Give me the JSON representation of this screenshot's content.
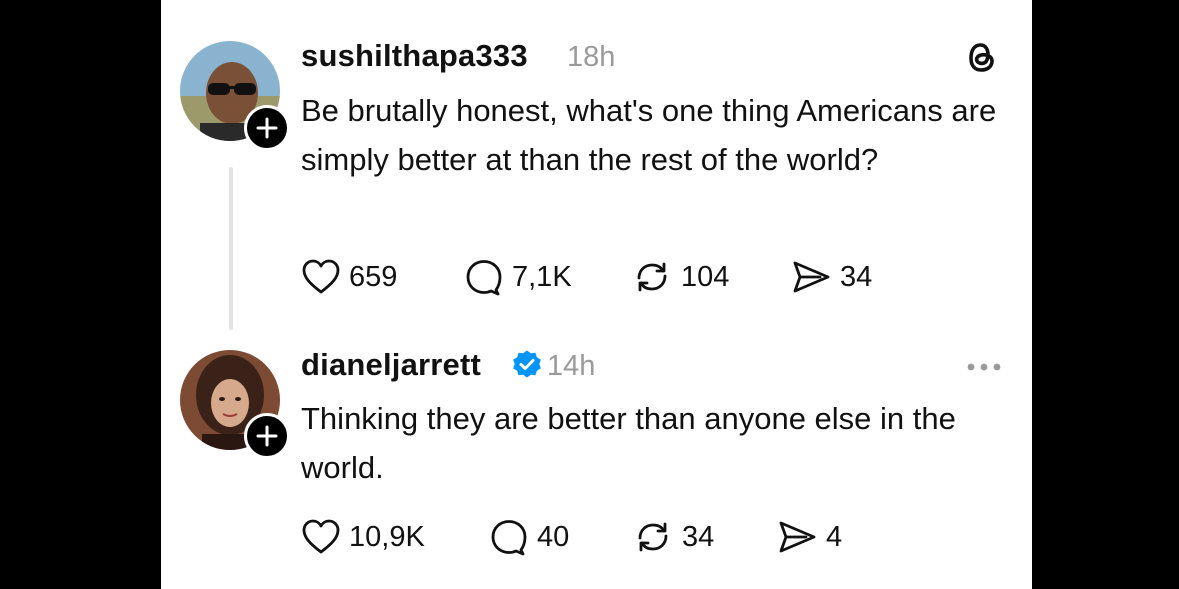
{
  "posts": [
    {
      "username": "sushilthapa333",
      "verified": false,
      "time": "18h",
      "text": "Be brutally honest, what's one thing Americans are simply better at than the rest of the world?",
      "likes": "659",
      "replies": "7,1K",
      "reposts": "104",
      "shares": "34",
      "top_right_icon": "threads-logo-icon"
    },
    {
      "username": "dianeljarrett",
      "verified": true,
      "time": "14h",
      "text": "Thinking they are better than anyone else in the world.",
      "likes": "10,9K",
      "replies": "40",
      "reposts": "34",
      "shares": "4",
      "top_right_icon": "more-options-icon"
    }
  ],
  "colors": {
    "text": "#111111",
    "muted": "#9a9a9a",
    "verified_badge": "#0095f6",
    "thread_line": "#e3e3e3",
    "outer_background": "#000000",
    "panel_background": "#ffffff"
  }
}
